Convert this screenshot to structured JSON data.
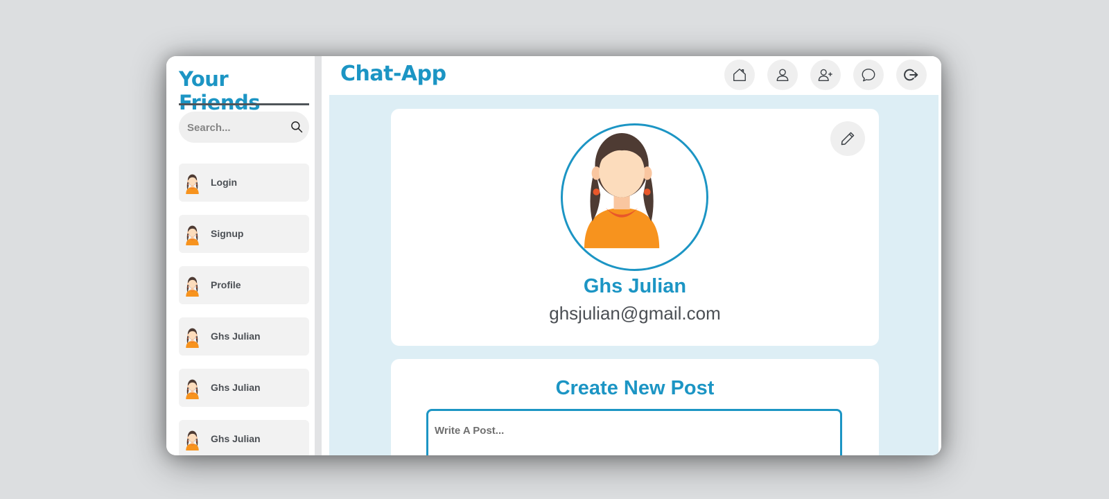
{
  "sidebar": {
    "title": "Your Friends",
    "search": {
      "placeholder": "Search...",
      "icon": "search-icon"
    },
    "friends": [
      {
        "name": "Login"
      },
      {
        "name": "Signup"
      },
      {
        "name": "Profile"
      },
      {
        "name": "Ghs Julian"
      },
      {
        "name": "Ghs Julian"
      },
      {
        "name": "Ghs Julian"
      }
    ]
  },
  "header": {
    "brand": "Chat-App",
    "nav_icons": [
      "home-icon",
      "user-icon",
      "user-add-icon",
      "chat-icon",
      "logout-icon"
    ]
  },
  "profile": {
    "name": "Ghs Julian",
    "email": "ghsjulian@gmail.com",
    "edit_icon": "pencil-icon"
  },
  "post": {
    "title": "Create New Post",
    "placeholder": "Write A Post..."
  },
  "colors": {
    "accent": "#1c95c4",
    "content_bg": "#ddeef5",
    "button_bg": "#efefef",
    "text_dark": "#4b4f54"
  }
}
